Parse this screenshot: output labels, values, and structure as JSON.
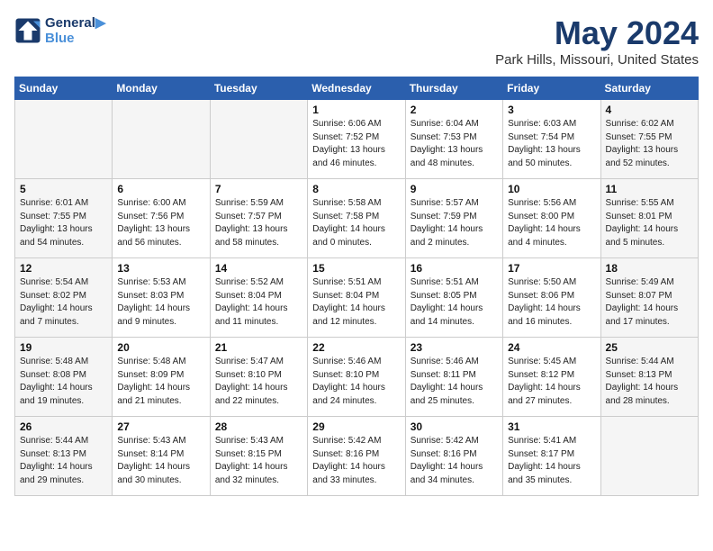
{
  "header": {
    "logo_line1": "General",
    "logo_line2": "Blue",
    "month": "May 2024",
    "location": "Park Hills, Missouri, United States"
  },
  "days_of_week": [
    "Sunday",
    "Monday",
    "Tuesday",
    "Wednesday",
    "Thursday",
    "Friday",
    "Saturday"
  ],
  "weeks": [
    [
      {
        "day": "",
        "info": ""
      },
      {
        "day": "",
        "info": ""
      },
      {
        "day": "",
        "info": ""
      },
      {
        "day": "1",
        "info": "Sunrise: 6:06 AM\nSunset: 7:52 PM\nDaylight: 13 hours\nand 46 minutes."
      },
      {
        "day": "2",
        "info": "Sunrise: 6:04 AM\nSunset: 7:53 PM\nDaylight: 13 hours\nand 48 minutes."
      },
      {
        "day": "3",
        "info": "Sunrise: 6:03 AM\nSunset: 7:54 PM\nDaylight: 13 hours\nand 50 minutes."
      },
      {
        "day": "4",
        "info": "Sunrise: 6:02 AM\nSunset: 7:55 PM\nDaylight: 13 hours\nand 52 minutes."
      }
    ],
    [
      {
        "day": "5",
        "info": "Sunrise: 6:01 AM\nSunset: 7:55 PM\nDaylight: 13 hours\nand 54 minutes."
      },
      {
        "day": "6",
        "info": "Sunrise: 6:00 AM\nSunset: 7:56 PM\nDaylight: 13 hours\nand 56 minutes."
      },
      {
        "day": "7",
        "info": "Sunrise: 5:59 AM\nSunset: 7:57 PM\nDaylight: 13 hours\nand 58 minutes."
      },
      {
        "day": "8",
        "info": "Sunrise: 5:58 AM\nSunset: 7:58 PM\nDaylight: 14 hours\nand 0 minutes."
      },
      {
        "day": "9",
        "info": "Sunrise: 5:57 AM\nSunset: 7:59 PM\nDaylight: 14 hours\nand 2 minutes."
      },
      {
        "day": "10",
        "info": "Sunrise: 5:56 AM\nSunset: 8:00 PM\nDaylight: 14 hours\nand 4 minutes."
      },
      {
        "day": "11",
        "info": "Sunrise: 5:55 AM\nSunset: 8:01 PM\nDaylight: 14 hours\nand 5 minutes."
      }
    ],
    [
      {
        "day": "12",
        "info": "Sunrise: 5:54 AM\nSunset: 8:02 PM\nDaylight: 14 hours\nand 7 minutes."
      },
      {
        "day": "13",
        "info": "Sunrise: 5:53 AM\nSunset: 8:03 PM\nDaylight: 14 hours\nand 9 minutes."
      },
      {
        "day": "14",
        "info": "Sunrise: 5:52 AM\nSunset: 8:04 PM\nDaylight: 14 hours\nand 11 minutes."
      },
      {
        "day": "15",
        "info": "Sunrise: 5:51 AM\nSunset: 8:04 PM\nDaylight: 14 hours\nand 12 minutes."
      },
      {
        "day": "16",
        "info": "Sunrise: 5:51 AM\nSunset: 8:05 PM\nDaylight: 14 hours\nand 14 minutes."
      },
      {
        "day": "17",
        "info": "Sunrise: 5:50 AM\nSunset: 8:06 PM\nDaylight: 14 hours\nand 16 minutes."
      },
      {
        "day": "18",
        "info": "Sunrise: 5:49 AM\nSunset: 8:07 PM\nDaylight: 14 hours\nand 17 minutes."
      }
    ],
    [
      {
        "day": "19",
        "info": "Sunrise: 5:48 AM\nSunset: 8:08 PM\nDaylight: 14 hours\nand 19 minutes."
      },
      {
        "day": "20",
        "info": "Sunrise: 5:48 AM\nSunset: 8:09 PM\nDaylight: 14 hours\nand 21 minutes."
      },
      {
        "day": "21",
        "info": "Sunrise: 5:47 AM\nSunset: 8:10 PM\nDaylight: 14 hours\nand 22 minutes."
      },
      {
        "day": "22",
        "info": "Sunrise: 5:46 AM\nSunset: 8:10 PM\nDaylight: 14 hours\nand 24 minutes."
      },
      {
        "day": "23",
        "info": "Sunrise: 5:46 AM\nSunset: 8:11 PM\nDaylight: 14 hours\nand 25 minutes."
      },
      {
        "day": "24",
        "info": "Sunrise: 5:45 AM\nSunset: 8:12 PM\nDaylight: 14 hours\nand 27 minutes."
      },
      {
        "day": "25",
        "info": "Sunrise: 5:44 AM\nSunset: 8:13 PM\nDaylight: 14 hours\nand 28 minutes."
      }
    ],
    [
      {
        "day": "26",
        "info": "Sunrise: 5:44 AM\nSunset: 8:13 PM\nDaylight: 14 hours\nand 29 minutes."
      },
      {
        "day": "27",
        "info": "Sunrise: 5:43 AM\nSunset: 8:14 PM\nDaylight: 14 hours\nand 30 minutes."
      },
      {
        "day": "28",
        "info": "Sunrise: 5:43 AM\nSunset: 8:15 PM\nDaylight: 14 hours\nand 32 minutes."
      },
      {
        "day": "29",
        "info": "Sunrise: 5:42 AM\nSunset: 8:16 PM\nDaylight: 14 hours\nand 33 minutes."
      },
      {
        "day": "30",
        "info": "Sunrise: 5:42 AM\nSunset: 8:16 PM\nDaylight: 14 hours\nand 34 minutes."
      },
      {
        "day": "31",
        "info": "Sunrise: 5:41 AM\nSunset: 8:17 PM\nDaylight: 14 hours\nand 35 minutes."
      },
      {
        "day": "",
        "info": ""
      }
    ]
  ]
}
